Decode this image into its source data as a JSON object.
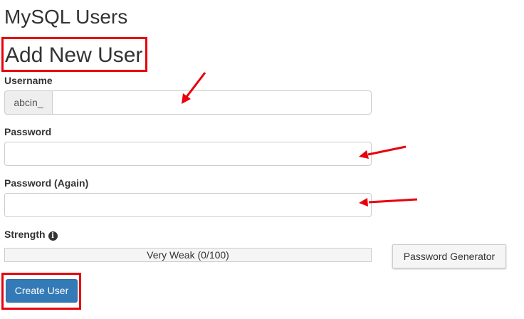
{
  "page": {
    "title": "MySQL Users"
  },
  "section": {
    "title": "Add New User"
  },
  "form": {
    "username": {
      "label": "Username",
      "prefix": "abcin_",
      "value": ""
    },
    "password": {
      "label": "Password",
      "value": ""
    },
    "password_again": {
      "label": "Password (Again)",
      "value": ""
    },
    "strength": {
      "label": "Strength",
      "text": "Very Weak (0/100)",
      "value": 0,
      "max": 100
    },
    "password_generator_label": "Password Generator",
    "create_user_label": "Create User"
  },
  "annotations": {
    "highlight_color": "#e8000b",
    "arrow_color": "#e8000b"
  }
}
